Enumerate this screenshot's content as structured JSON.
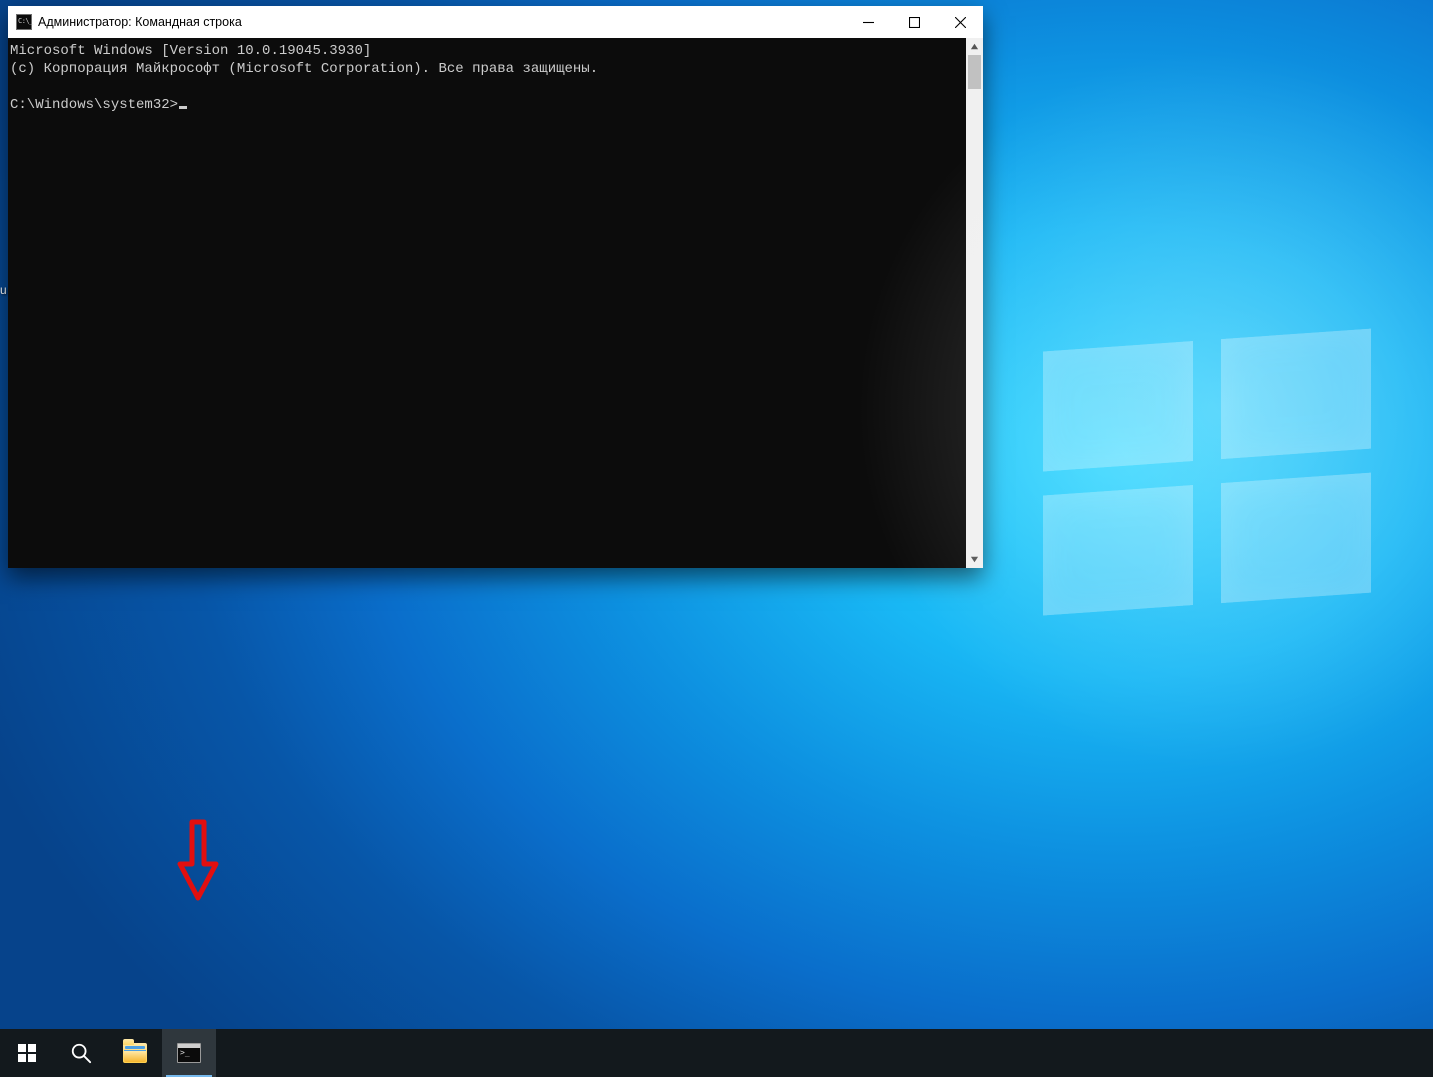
{
  "window": {
    "title": "Администратор: Командная строка"
  },
  "console": {
    "line1": "Microsoft Windows [Version 10.0.19045.3930]",
    "line2": "(c) Корпорация Майкрософт (Microsoft Corporation). Все права защищены.",
    "prompt": "C:\\Windows\\system32>"
  },
  "desktop": {
    "cut_label_1": "u",
    "cut_label_2": " "
  },
  "taskbar": {
    "start": "start-button",
    "search": "search-button",
    "explorer": "file-explorer-button",
    "cmd": "command-prompt-button"
  }
}
